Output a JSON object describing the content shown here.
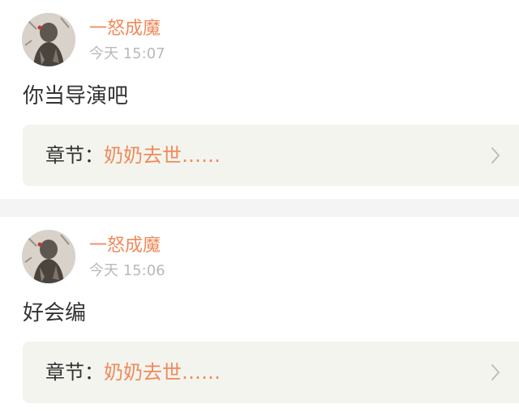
{
  "comments": [
    {
      "username": "一怒成魔",
      "timestamp": "今天 15:07",
      "text": "你当导演吧",
      "chapter_label": "章节：",
      "chapter_title": "奶奶去世……"
    },
    {
      "username": "一怒成魔",
      "timestamp": "今天 15:06",
      "text": "好会编",
      "chapter_label": "章节：",
      "chapter_title": "奶奶去世……"
    }
  ],
  "colors": {
    "username": "#ef8a5a",
    "timestamp": "#b9b9b9",
    "text": "#333333",
    "chapter_bg": "#f4f4ef",
    "separator": "#f4f4f4"
  },
  "icons": {
    "chapter_arrow": "chevron-right-icon"
  }
}
